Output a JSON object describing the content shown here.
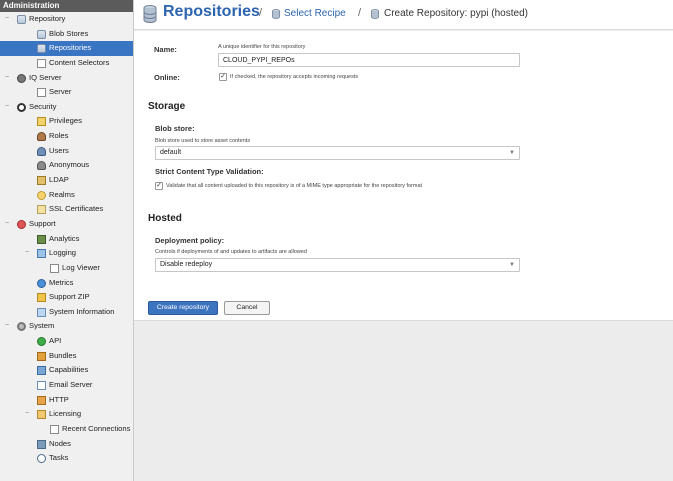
{
  "sidebar": {
    "header": "Administration",
    "items": [
      {
        "label": "Repository",
        "icon": "database-icon"
      },
      {
        "label": "Blob Stores",
        "icon": "database-icon"
      },
      {
        "label": "Repositories",
        "icon": "database-icon",
        "selected": true
      },
      {
        "label": "Content Selectors",
        "icon": "page-icon"
      },
      {
        "label": "IQ Server",
        "icon": "iq-server-icon"
      },
      {
        "label": "Server",
        "icon": "page-icon"
      },
      {
        "label": "Security",
        "icon": "eye-icon"
      },
      {
        "label": "Privileges",
        "icon": "privileges-icon"
      },
      {
        "label": "Roles",
        "icon": "roles-icon"
      },
      {
        "label": "Users",
        "icon": "users-icon"
      },
      {
        "label": "Anonymous",
        "icon": "anonymous-icon"
      },
      {
        "label": "LDAP",
        "icon": "ldap-icon"
      },
      {
        "label": "Realms",
        "icon": "realms-icon"
      },
      {
        "label": "SSL Certificates",
        "icon": "certificate-icon"
      },
      {
        "label": "Support",
        "icon": "support-icon"
      },
      {
        "label": "Analytics",
        "icon": "analytics-icon"
      },
      {
        "label": "Logging",
        "icon": "logging-icon"
      },
      {
        "label": "Log Viewer",
        "icon": "log-viewer-icon"
      },
      {
        "label": "Metrics",
        "icon": "metrics-icon"
      },
      {
        "label": "Support ZIP",
        "icon": "zip-icon"
      },
      {
        "label": "System Information",
        "icon": "system-information-icon"
      },
      {
        "label": "System",
        "icon": "gear-icon"
      },
      {
        "label": "API",
        "icon": "api-icon"
      },
      {
        "label": "Bundles",
        "icon": "bundles-icon"
      },
      {
        "label": "Capabilities",
        "icon": "capabilities-icon"
      },
      {
        "label": "Email Server",
        "icon": "email-icon"
      },
      {
        "label": "HTTP",
        "icon": "http-icon"
      },
      {
        "label": "Licensing",
        "icon": "licensing-icon"
      },
      {
        "label": "Recent Connections",
        "icon": "page-icon"
      },
      {
        "label": "Nodes",
        "icon": "nodes-icon"
      },
      {
        "label": "Tasks",
        "icon": "tasks-icon"
      }
    ]
  },
  "header": {
    "title": "Repositories",
    "separator": "/",
    "crumb_select": "Select Recipe",
    "crumb_create": "Create Repository: pypi (hosted)"
  },
  "form": {
    "name_label": "Name:",
    "name_help": "A unique identifier for this repository",
    "name_value": "CLOUD_PYPI_REPOs",
    "online_label": "Online:",
    "online_help": "If checked, the repository accepts incoming requests",
    "online_checked": true,
    "storage_title": "Storage",
    "blob_store_label": "Blob store:",
    "blob_store_help": "Blob store used to store asset contents",
    "blob_store_value": "default",
    "strict_label": "Strict Content Type Validation:",
    "strict_help": "Validate that all content uploaded to this repository is of a MIME type appropriate for the repository format",
    "strict_checked": true,
    "hosted_title": "Hosted",
    "deploy_label": "Deployment policy:",
    "deploy_help": "Controls if deployments of and updates to artifacts are allowed",
    "deploy_value": "Disable redeploy",
    "create_button": "Create repository",
    "cancel_button": "Cancel",
    "check_glyph": "✓",
    "dropdown_glyph": "▼"
  },
  "colors": {
    "accent": "#2d64b0",
    "selected_bg": "#3a75c4",
    "primary_button": "#3d74bf"
  }
}
